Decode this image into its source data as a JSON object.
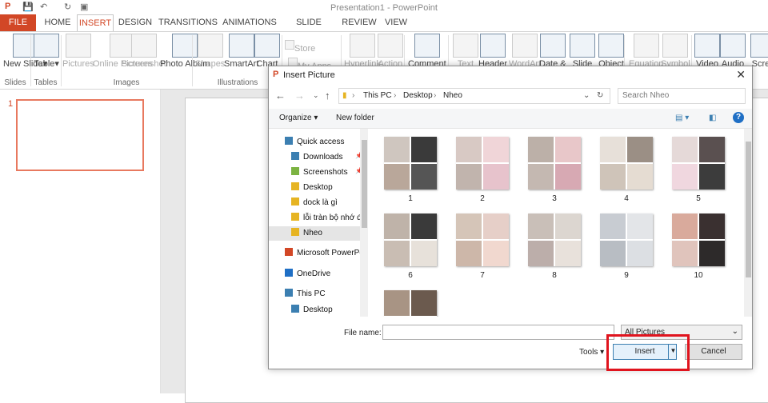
{
  "window": {
    "title": "Presentation1 - PowerPoint"
  },
  "tabs": [
    "FILE",
    "HOME",
    "INSERT",
    "DESIGN",
    "TRANSITIONS",
    "ANIMATIONS",
    "SLIDE SHOW",
    "REVIEW",
    "VIEW"
  ],
  "ribbon": {
    "buttons": [
      {
        "label": "New Slide",
        "sub": "▾",
        "icon": "new-slide-icon"
      },
      {
        "label": "Table",
        "sub": "▾",
        "icon": "table-icon"
      },
      {
        "label": "Pictures",
        "icon": "pictures-icon"
      },
      {
        "label": "Online Pictures",
        "icon": "online-pictures-icon"
      },
      {
        "label": "Screenshot",
        "icon": "screenshot-icon"
      },
      {
        "label": "Photo Album",
        "icon": "photo-album-icon"
      },
      {
        "label": "Shapes",
        "icon": "shapes-icon"
      },
      {
        "label": "SmartArt",
        "icon": "smartart-icon"
      },
      {
        "label": "Chart",
        "icon": "chart-icon"
      },
      {
        "label": "Store",
        "icon": "store-icon"
      },
      {
        "label": "My Apps",
        "icon": "my-apps-icon"
      },
      {
        "label": "Hyperlink",
        "icon": "hyperlink-icon"
      },
      {
        "label": "Action",
        "icon": "action-icon"
      },
      {
        "label": "Comment",
        "icon": "comment-icon"
      },
      {
        "label": "Text",
        "icon": "text-box-icon"
      },
      {
        "label": "Header",
        "icon": "header-icon"
      },
      {
        "label": "WordArt",
        "icon": "wordart-icon"
      },
      {
        "label": "Date &",
        "icon": "date-icon"
      },
      {
        "label": "Slide",
        "icon": "slide-number-icon"
      },
      {
        "label": "Object",
        "icon": "object-icon"
      },
      {
        "label": "Equation",
        "icon": "equation-icon"
      },
      {
        "label": "Symbol",
        "icon": "symbol-icon"
      },
      {
        "label": "Video",
        "icon": "video-icon"
      },
      {
        "label": "Audio",
        "icon": "audio-icon"
      },
      {
        "label": "Scree",
        "icon": "screen-record-icon"
      }
    ],
    "groups": [
      "Slides",
      "Tables",
      "Images",
      "Illustrations"
    ]
  },
  "slide_pane": {
    "slide_number": "1"
  },
  "dialog": {
    "title": "Insert Picture",
    "path": [
      "This PC",
      "Desktop",
      "Nheo"
    ],
    "search_placeholder": "Search Nheo",
    "organize": "Organize ▾",
    "new_folder": "New folder",
    "nav": [
      {
        "label": "Quick access",
        "icon": "star-icon"
      },
      {
        "label": "Downloads",
        "icon": "downloads-icon",
        "pin": "📌"
      },
      {
        "label": "Screenshots",
        "icon": "screenshots-folder-icon",
        "pin": "📌"
      },
      {
        "label": "Desktop",
        "icon": "folder-icon"
      },
      {
        "label": "dock là gì",
        "icon": "folder-icon"
      },
      {
        "label": "lỗi tràn bộ nhớ đ",
        "icon": "folder-icon"
      },
      {
        "label": "Nheo",
        "icon": "folder-icon"
      },
      {
        "label": "Microsoft PowerPo",
        "icon": "powerpoint-icon"
      },
      {
        "label": "OneDrive",
        "icon": "onedrive-icon"
      },
      {
        "label": "This PC",
        "icon": "this-pc-icon"
      },
      {
        "label": "Desktop",
        "icon": "desktop-icon"
      }
    ],
    "files": [
      "1",
      "2",
      "3",
      "4",
      "5",
      "6",
      "7",
      "8",
      "9",
      "10",
      ""
    ],
    "file_name_label": "File name:",
    "file_name_value": "",
    "file_type": "All Pictures",
    "tools": "Tools",
    "insert": "Insert",
    "cancel": "Cancel"
  },
  "colors": {
    "accent": "#d24726",
    "highlight": "#e0141e"
  }
}
